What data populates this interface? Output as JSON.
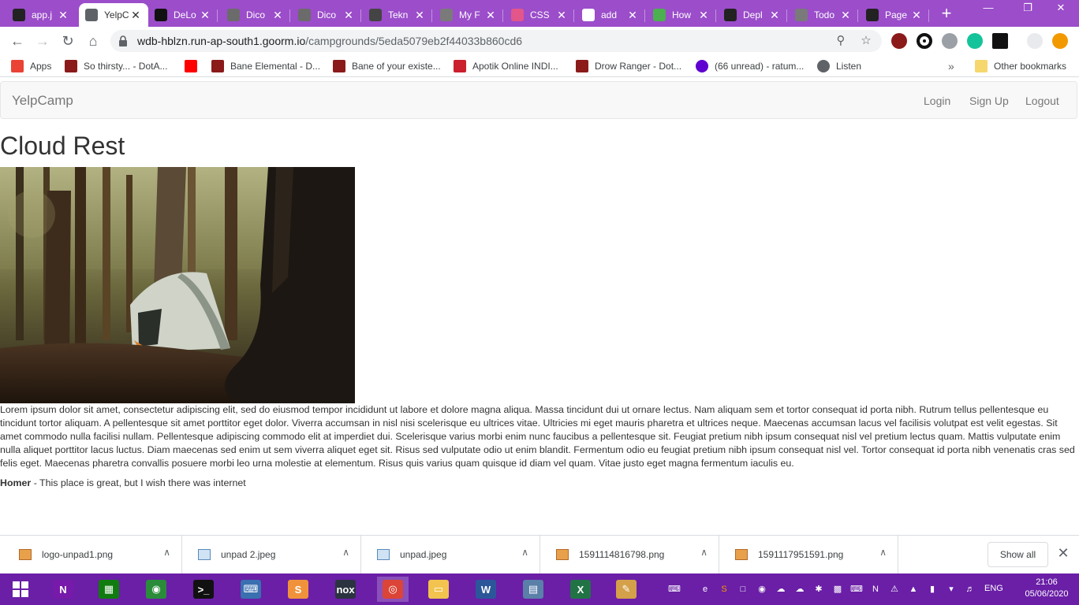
{
  "tabs": [
    {
      "title": "app.j",
      "favicon": "terminal-icon",
      "color": "#222222"
    },
    {
      "title": "YelpC",
      "favicon": "globe-icon",
      "color": "#5f6368"
    },
    {
      "title": "DeLo",
      "favicon": "dev-icon",
      "color": "#111111"
    },
    {
      "title": "Dico",
      "favicon": "g-icon",
      "color": "#6b6b6b"
    },
    {
      "title": "Dico",
      "favicon": "g-icon",
      "color": "#6b6b6b"
    },
    {
      "title": "Tekn",
      "favicon": "g-icon",
      "color": "#444444"
    },
    {
      "title": "My F",
      "favicon": "globe-icon",
      "color": "#7a7a7a"
    },
    {
      "title": "CSS",
      "favicon": "codepen-icon",
      "color": "#e3568a"
    },
    {
      "title": "add",
      "favicon": "google-icon",
      "color": "#ffffff"
    },
    {
      "title": "How",
      "favicon": "w3-icon",
      "color": "#4caf50"
    },
    {
      "title": "Depl",
      "favicon": "github-icon",
      "color": "#222222"
    },
    {
      "title": "Todo",
      "favicon": "globe-icon",
      "color": "#7a7a7a"
    },
    {
      "title": "Page",
      "favicon": "github-icon",
      "color": "#222222"
    }
  ],
  "browser": {
    "url_host": "wdb-hblzn.run-ap-south1.goorm.io",
    "url_path": "/campgrounds/5eda5079eb2f44033b860cd6"
  },
  "bookmarks": [
    {
      "label": "Apps",
      "icon": "apps-grid-icon"
    },
    {
      "label": "So thirsty... - DotA...",
      "icon": "dota-icon"
    },
    {
      "label": "",
      "icon": "youtube-icon"
    },
    {
      "label": "Bane Elemental - D...",
      "icon": "dota-icon"
    },
    {
      "label": "Bane of your existe...",
      "icon": "dota-icon"
    },
    {
      "label": "Apotik Online INDI...",
      "icon": "apotik-icon"
    },
    {
      "label": "Drow Ranger - Dot...",
      "icon": "dota-icon"
    },
    {
      "label": "(66 unread) - ratum...",
      "icon": "yahoo-icon"
    },
    {
      "label": "Listen",
      "icon": "globe-icon"
    }
  ],
  "bookmarks_more": "»",
  "other_bookmarks": "Other bookmarks",
  "app": {
    "brand": "YelpCamp",
    "nav": [
      "Login",
      "Sign Up",
      "Logout"
    ],
    "campground_name": "Cloud Rest",
    "description": "Lorem ipsum dolor sit amet, consectetur adipiscing elit, sed do eiusmod tempor incididunt ut labore et dolore magna aliqua. Massa tincidunt dui ut ornare lectus. Nam aliquam sem et tortor consequat id porta nibh. Rutrum tellus pellentesque eu tincidunt tortor aliquam. A pellentesque sit amet porttitor eget dolor. Viverra accumsan in nisl nisi scelerisque eu ultrices vitae. Ultricies mi eget mauris pharetra et ultrices neque. Maecenas accumsan lacus vel facilisis volutpat est velit egestas. Sit amet commodo nulla facilisi nullam. Pellentesque adipiscing commodo elit at imperdiet dui. Scelerisque varius morbi enim nunc faucibus a pellentesque sit. Feugiat pretium nibh ipsum consequat nisl vel pretium lectus quam. Mattis vulputate enim nulla aliquet porttitor lacus luctus. Diam maecenas sed enim ut sem viverra aliquet eget sit. Risus sed vulputate odio ut enim blandit. Fermentum odio eu feugiat pretium nibh ipsum consequat nisl vel. Tortor consequat id porta nibh venenatis cras sed felis eget. Maecenas pharetra convallis posuere morbi leo urna molestie at elementum. Risus quis varius quam quisque id diam vel quam. Vitae justo eget magna fermentum iaculis eu.",
    "comment_author": "Homer",
    "comment_text": " - This place is great, but I wish there was internet"
  },
  "downloads": [
    {
      "name": "logo-unpad1.png",
      "icon": "image-file-icon"
    },
    {
      "name": "unpad 2.jpeg",
      "icon": "image-file-icon"
    },
    {
      "name": "unpad.jpeg",
      "icon": "image-file-icon"
    },
    {
      "name": "1591114816798.png",
      "icon": "image-file-icon"
    },
    {
      "name": "1591117951591.png",
      "icon": "image-file-icon"
    }
  ],
  "show_all": "Show all",
  "taskbar": {
    "apps": [
      {
        "name": "windows-start",
        "glyph": "",
        "color": "transparent"
      },
      {
        "name": "onenote",
        "glyph": "N",
        "color": "#7719aa"
      },
      {
        "name": "store",
        "glyph": "▦",
        "color": "#107c10"
      },
      {
        "name": "earth",
        "glyph": "◉",
        "color": "#2a8c3a"
      },
      {
        "name": "cmd",
        "glyph": ">_",
        "color": "#111111"
      },
      {
        "name": "keyboard",
        "glyph": "⌨",
        "color": "#3a6fb0"
      },
      {
        "name": "sublime",
        "glyph": "S",
        "color": "#f0923b"
      },
      {
        "name": "nox",
        "glyph": "nox",
        "color": "#2b3340"
      },
      {
        "name": "chrome",
        "glyph": "◎",
        "color": "#db4437"
      },
      {
        "name": "explorer",
        "glyph": "▭",
        "color": "#f2c34e"
      },
      {
        "name": "word",
        "glyph": "W",
        "color": "#2b579a"
      },
      {
        "name": "monitor",
        "glyph": "▤",
        "color": "#5a7fa8"
      },
      {
        "name": "excel",
        "glyph": "X",
        "color": "#217346"
      },
      {
        "name": "paint",
        "glyph": "✎",
        "color": "#d4a04a"
      }
    ],
    "language": "ENG",
    "time": "21:06",
    "date": "05/06/2020"
  }
}
